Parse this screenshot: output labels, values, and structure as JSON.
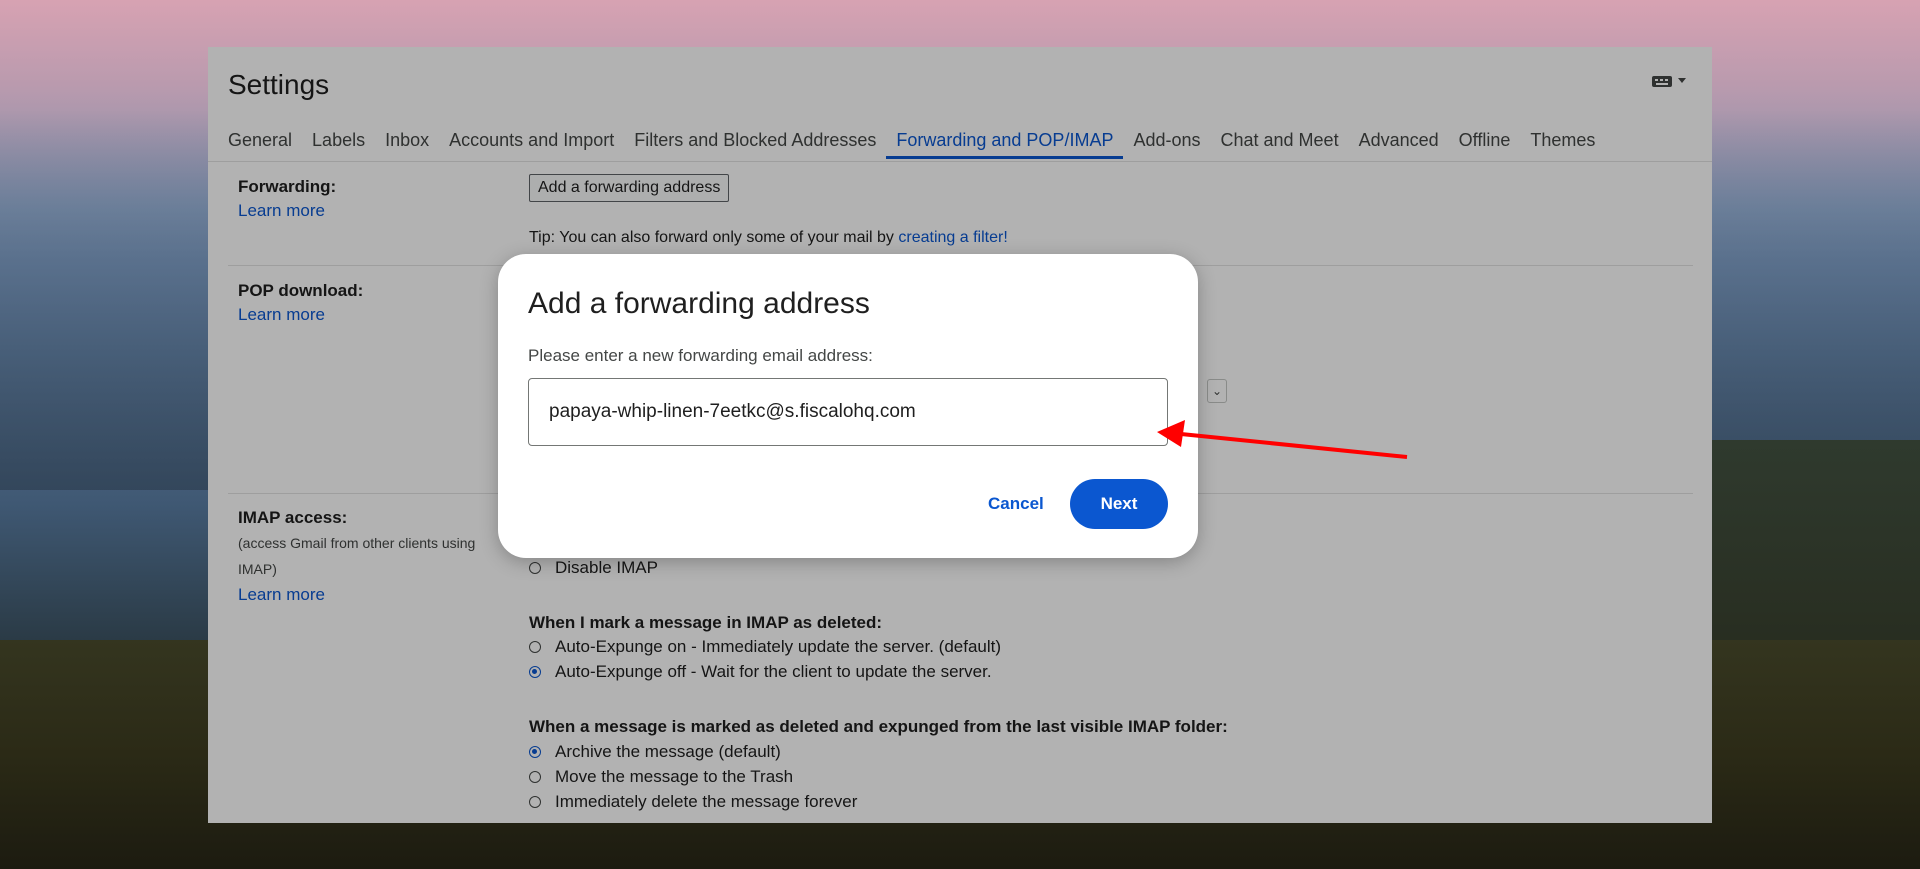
{
  "window": {
    "title": "Settings"
  },
  "tabs": [
    {
      "label": "General"
    },
    {
      "label": "Labels"
    },
    {
      "label": "Inbox"
    },
    {
      "label": "Accounts and Import"
    },
    {
      "label": "Filters and Blocked Addresses"
    },
    {
      "label": "Forwarding and POP/IMAP",
      "active": true
    },
    {
      "label": "Add-ons"
    },
    {
      "label": "Chat and Meet"
    },
    {
      "label": "Advanced"
    },
    {
      "label": "Offline"
    },
    {
      "label": "Themes"
    }
  ],
  "forwarding": {
    "label": "Forwarding:",
    "learn_more": "Learn more",
    "add_button": "Add a forwarding address",
    "tip_prefix": "Tip: You can also forward only some of your mail by",
    "tip_link": "creating a filter!"
  },
  "pop": {
    "label": "POP download:",
    "learn_more": "Learn more"
  },
  "imap": {
    "label": "IMAP access:",
    "desc": "(access Gmail from other clients using",
    "desc2": "IMAP)",
    "learn_more": "Learn more",
    "disable": "Disable IMAP",
    "deleted_heading": "When I mark a message in IMAP as deleted:",
    "deleted_options": [
      {
        "label": "Auto-Expunge on - Immediately update the server. (default)",
        "selected": false
      },
      {
        "label": "Auto-Expunge off - Wait for the client to update the server.",
        "selected": true
      }
    ],
    "expunged_heading": "When a message is marked as deleted and expunged from the last visible IMAP folder:",
    "expunged_options": [
      {
        "label": "Archive the message (default)",
        "selected": true
      },
      {
        "label": "Move the message to the Trash",
        "selected": false
      },
      {
        "label": "Immediately delete the message forever",
        "selected": false
      }
    ]
  },
  "dialog": {
    "title": "Add a forwarding address",
    "prompt": "Please enter a new forwarding email address:",
    "input_value": "papaya-whip-linen-7eetkc@s.fiscalohq.com",
    "cancel": "Cancel",
    "next": "Next"
  },
  "colors": {
    "accent": "#0b57d0",
    "annotation_arrow": "#ff0000"
  }
}
